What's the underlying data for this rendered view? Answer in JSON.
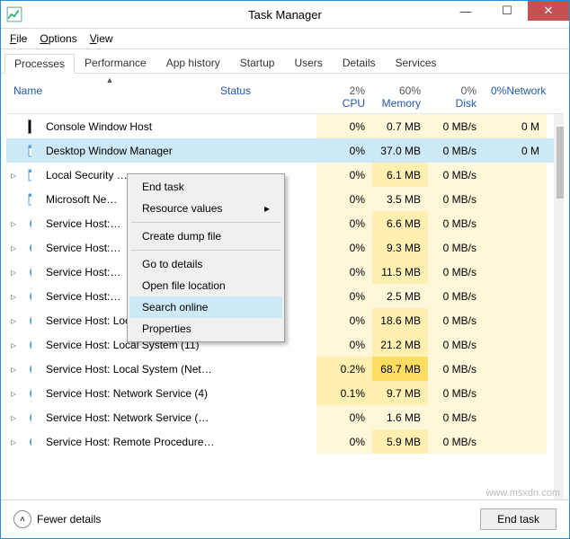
{
  "window_title": "Task Manager",
  "menu": {
    "file": "File",
    "options": "Options",
    "view": "View"
  },
  "tabs": [
    "Processes",
    "Performance",
    "App history",
    "Startup",
    "Users",
    "Details",
    "Services"
  ],
  "active_tab": 0,
  "columns": {
    "name": "Name",
    "status": "Status",
    "cpu_top": "2%",
    "cpu_bot": "CPU",
    "mem_top": "60%",
    "mem_bot": "Memory",
    "disk_top": "0%",
    "disk_bot": "Disk",
    "net_top": "0%",
    "net_bot": "Network"
  },
  "processes": [
    {
      "icon": "cmd",
      "expand": "",
      "name": "Console Window Host",
      "cpu": "0%",
      "mem": "0.7 MB",
      "mem_cls": "",
      "disk": "0 MB/s",
      "net": "0 M",
      "selected": false
    },
    {
      "icon": "win",
      "expand": "",
      "name": "Desktop Window Manager",
      "cpu": "0%",
      "mem": "37.0 MB",
      "mem_cls": "mem-m2",
      "disk": "0 MB/s",
      "net": "0 M",
      "selected": true
    },
    {
      "icon": "win",
      "expand": "▹",
      "name": "Local Security …",
      "cpu": "0%",
      "mem": "6.1 MB",
      "mem_cls": "mem-m1",
      "disk": "0 MB/s",
      "net": ""
    },
    {
      "icon": "win",
      "expand": "",
      "name": "Microsoft Ne…",
      "cpu": "0%",
      "mem": "3.5 MB",
      "mem_cls": "",
      "disk": "0 MB/s",
      "net": ""
    },
    {
      "icon": "gear",
      "expand": "▹",
      "name": "Service Host:…",
      "cpu": "0%",
      "mem": "6.6 MB",
      "mem_cls": "mem-m1",
      "disk": "0 MB/s",
      "net": ""
    },
    {
      "icon": "gear",
      "expand": "▹",
      "name": "Service Host:…",
      "cpu": "0%",
      "mem": "9.3 MB",
      "mem_cls": "mem-m1",
      "disk": "0 MB/s",
      "net": ""
    },
    {
      "icon": "gear",
      "expand": "▹",
      "name": "Service Host:…",
      "cpu": "0%",
      "mem": "11.5 MB",
      "mem_cls": "mem-m1",
      "disk": "0 MB/s",
      "net": ""
    },
    {
      "icon": "gear",
      "expand": "▹",
      "name": "Service Host:…",
      "cpu": "0%",
      "mem": "2.5 MB",
      "mem_cls": "",
      "disk": "0 MB/s",
      "net": ""
    },
    {
      "icon": "gear",
      "expand": "▹",
      "name": "Service Host: Local Service (No …",
      "cpu": "0%",
      "mem": "18.6 MB",
      "mem_cls": "mem-m1",
      "disk": "0 MB/s",
      "net": ""
    },
    {
      "icon": "gear",
      "expand": "▹",
      "name": "Service Host: Local System (11)",
      "cpu": "0%",
      "mem": "21.2 MB",
      "mem_cls": "mem-m1",
      "disk": "0 MB/s",
      "net": ""
    },
    {
      "icon": "gear",
      "expand": "▹",
      "name": "Service Host: Local System (Net…",
      "cpu": "0.2%",
      "cpu_cls": "cpu-c1",
      "mem": "68.7 MB",
      "mem_cls": "mem-m3",
      "disk": "0 MB/s",
      "net": ""
    },
    {
      "icon": "gear",
      "expand": "▹",
      "name": "Service Host: Network Service (4)",
      "cpu": "0.1%",
      "cpu_cls": "cpu-c1",
      "mem": "9.7 MB",
      "mem_cls": "mem-m1",
      "disk": "0 MB/s",
      "net": ""
    },
    {
      "icon": "gear",
      "expand": "▹",
      "name": "Service Host: Network Service (…",
      "cpu": "0%",
      "mem": "1.6 MB",
      "mem_cls": "",
      "disk": "0 MB/s",
      "net": ""
    },
    {
      "icon": "gear",
      "expand": "▹",
      "name": "Service Host: Remote Procedure…",
      "cpu": "0%",
      "mem": "5.9 MB",
      "mem_cls": "mem-m1",
      "disk": "0 MB/s",
      "net": ""
    }
  ],
  "context_menu": {
    "items": [
      {
        "label": "End task"
      },
      {
        "label": "Resource values",
        "arrow": true
      },
      {
        "sep": true
      },
      {
        "label": "Create dump file"
      },
      {
        "sep": true
      },
      {
        "label": "Go to details"
      },
      {
        "label": "Open file location"
      },
      {
        "label": "Search online",
        "hover": true
      },
      {
        "label": "Properties"
      }
    ]
  },
  "footer": {
    "fewer": "Fewer details",
    "end_task": "End task"
  },
  "watermark": "www.msxdn.com"
}
